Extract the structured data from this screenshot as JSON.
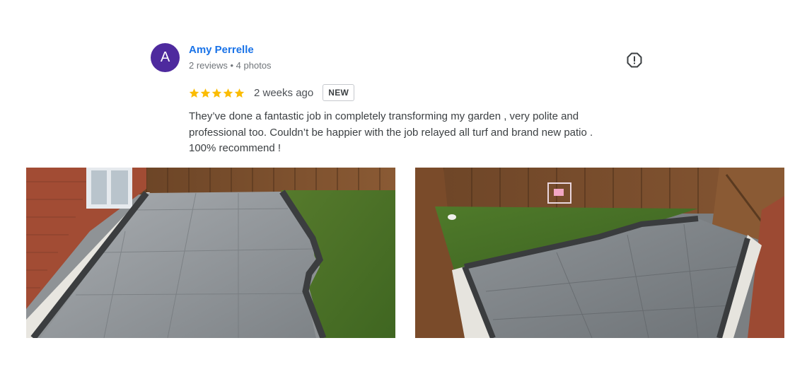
{
  "reviewer": {
    "initial": "A",
    "name": "Amy Perrelle",
    "meta": "2 reviews • 4 photos",
    "avatar_color": "#4e2a9e"
  },
  "rating": {
    "stars": 5,
    "max": 5,
    "star_color": "#fbbc04",
    "time": "2 weeks ago",
    "badge": "NEW"
  },
  "review_text": {
    "lines": [
      "They’ve done a fantastic job in completely transforming my garden , very polite and",
      "professional too. Couldn’t be happier with the job relayed all turf and brand new patio .",
      "100% recommend !"
    ]
  },
  "icons": {
    "report": "report-flag-icon",
    "star": "star-icon"
  },
  "photos": [
    {
      "subject": "patio-with-lawn-brick-house-left"
    },
    {
      "subject": "garden-lawn-patio-fence-swing"
    }
  ]
}
